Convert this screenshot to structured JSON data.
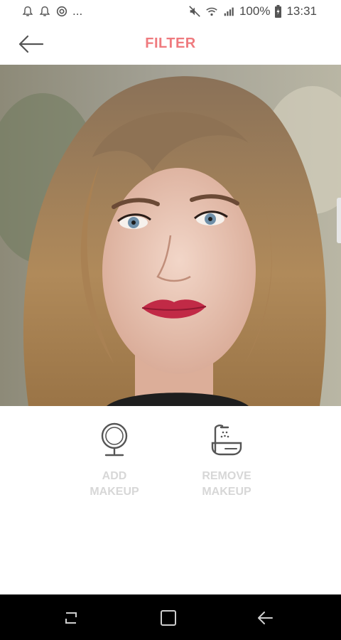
{
  "status_bar": {
    "left_icons": [
      "notification-bell-icon",
      "notification-bell-icon",
      "sync-icon"
    ],
    "more_indicator": "...",
    "right_icons": [
      "mute-icon",
      "wifi-icon",
      "signal-icon"
    ],
    "battery_percent": "100%",
    "time": "13:31"
  },
  "header": {
    "back_icon": "arrow-left-icon",
    "title": "FILTER",
    "title_color": "#ef7a7e"
  },
  "actions": {
    "add": {
      "icon": "mirror-icon",
      "label": "ADD\nMAKEUP"
    },
    "remove": {
      "icon": "sink-icon",
      "label": "REMOVE\nMAKEUP"
    },
    "label_color": "#d7d7d7"
  },
  "navbar": {
    "recent_icon": "recent-apps-icon",
    "home_icon": "home-icon",
    "back_icon": "back-icon"
  }
}
